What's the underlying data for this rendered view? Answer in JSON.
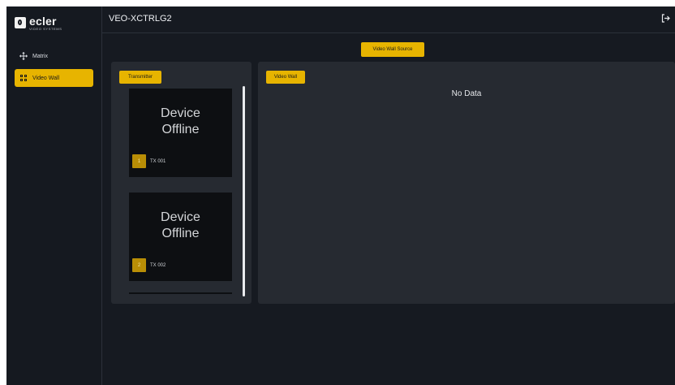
{
  "brand": {
    "name": "ecler",
    "subtitle": "VIDEO SYSTEMS"
  },
  "header": {
    "title": "VEO-XCTRLG2",
    "logout_icon": "logout-icon"
  },
  "sidebar": {
    "items": [
      {
        "label": "Matrix",
        "icon": "move-icon",
        "active": false
      },
      {
        "label": "Video Wall",
        "icon": "grid-icon",
        "active": true
      }
    ]
  },
  "main": {
    "source_button": "Video Wall Source",
    "transmitter_button": "Transmitter",
    "videowall_button": "Video Wall",
    "no_data": "No Data",
    "transmitters": [
      {
        "status_line1": "Device",
        "status_line2": "Offline",
        "index": "1",
        "name": "TX 001"
      },
      {
        "status_line1": "Device",
        "status_line2": "Offline",
        "index": "2",
        "name": "TX 002"
      }
    ]
  },
  "colors": {
    "accent": "#e7b400",
    "background": "#161a21",
    "panel": "#262a31",
    "tile": "#0d0f12"
  }
}
